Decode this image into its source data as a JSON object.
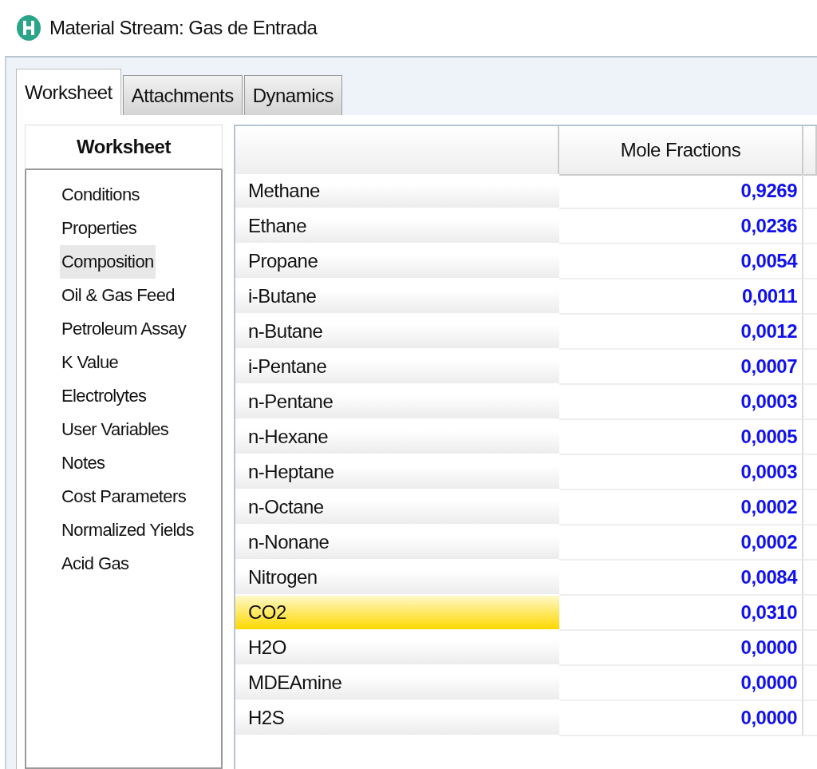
{
  "window": {
    "title": "Material Stream: Gas de Entrada"
  },
  "tabs": [
    {
      "label": "Worksheet",
      "selected": true
    },
    {
      "label": "Attachments",
      "selected": false
    },
    {
      "label": "Dynamics",
      "selected": false
    }
  ],
  "sidebar": {
    "header": "Worksheet",
    "items": [
      {
        "label": "Conditions",
        "selected": false
      },
      {
        "label": "Properties",
        "selected": false
      },
      {
        "label": "Composition",
        "selected": true
      },
      {
        "label": "Oil & Gas Feed",
        "selected": false
      },
      {
        "label": "Petroleum Assay",
        "selected": false
      },
      {
        "label": "K Value",
        "selected": false
      },
      {
        "label": "Electrolytes",
        "selected": false
      },
      {
        "label": "User Variables",
        "selected": false
      },
      {
        "label": "Notes",
        "selected": false
      },
      {
        "label": "Cost Parameters",
        "selected": false
      },
      {
        "label": "Normalized Yields",
        "selected": false
      },
      {
        "label": "Acid Gas",
        "selected": false
      }
    ]
  },
  "table": {
    "columns": [
      "Mole Fractions"
    ],
    "rows": [
      {
        "component": "Methane",
        "value": "0,9269",
        "selected": false
      },
      {
        "component": "Ethane",
        "value": "0,0236",
        "selected": false
      },
      {
        "component": "Propane",
        "value": "0,0054",
        "selected": false
      },
      {
        "component": "i-Butane",
        "value": "0,0011",
        "selected": false
      },
      {
        "component": "n-Butane",
        "value": "0,0012",
        "selected": false
      },
      {
        "component": "i-Pentane",
        "value": "0,0007",
        "selected": false
      },
      {
        "component": "n-Pentane",
        "value": "0,0003",
        "selected": false
      },
      {
        "component": "n-Hexane",
        "value": "0,0005",
        "selected": false
      },
      {
        "component": "n-Heptane",
        "value": "0,0003",
        "selected": false
      },
      {
        "component": "n-Octane",
        "value": "0,0002",
        "selected": false
      },
      {
        "component": "n-Nonane",
        "value": "0,0002",
        "selected": false
      },
      {
        "component": "Nitrogen",
        "value": "0,0084",
        "selected": false
      },
      {
        "component": "CO2",
        "value": "0,0310",
        "selected": true
      },
      {
        "component": "H2O",
        "value": "0,0000",
        "selected": false
      },
      {
        "component": "MDEAmine",
        "value": "0,0000",
        "selected": false
      },
      {
        "component": "H2S",
        "value": "0,0000",
        "selected": false
      }
    ]
  }
}
